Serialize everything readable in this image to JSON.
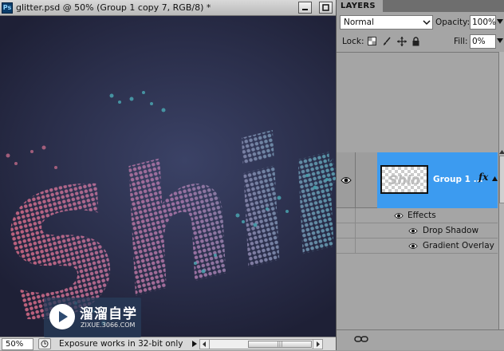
{
  "document": {
    "app_icon": "Ps",
    "title": "glitter.psd @ 50% (Group 1 copy 7, RGB/8) *",
    "canvas_art_text": "Shin",
    "status": {
      "zoom": "50%",
      "message": "Exposure works in 32-bit only"
    }
  },
  "layers_panel": {
    "tab_label": "LAYERS",
    "blend_mode": "Normal",
    "opacity_label": "Opacity:",
    "opacity_value": "100%",
    "lock_label": "Lock:",
    "fill_label": "Fill:",
    "fill_value": "0%",
    "layer": {
      "name": "Group 1 ...",
      "fx_label": "fx"
    },
    "effects_label": "Effects",
    "effects": [
      "Drop Shadow",
      "Gradient Overlay"
    ]
  },
  "watermark": {
    "title": "溜溜自学",
    "url": "ZIXUE.3066.COM"
  },
  "colors": {
    "selection_blue": "#3c9bf0",
    "canvas_bg": "#2a2e4a",
    "glitter_pink": "#c0607a",
    "glitter_teal": "#3aa0a8"
  }
}
